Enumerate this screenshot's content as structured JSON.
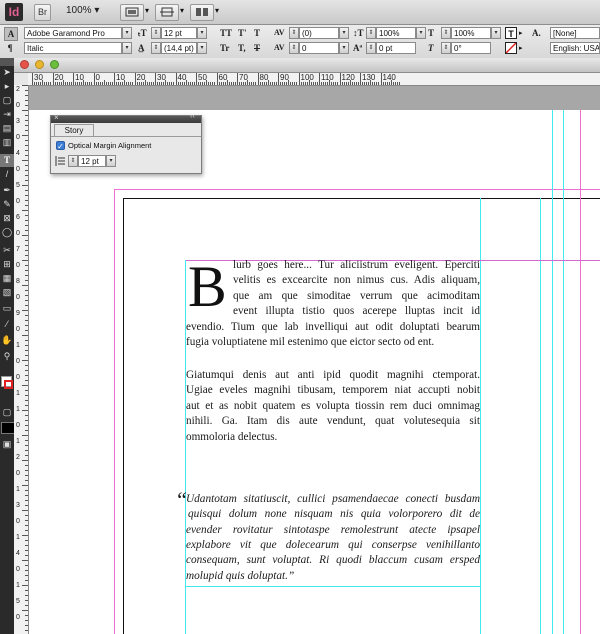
{
  "app": {
    "logo": "Id",
    "bridge_label": "Br",
    "zoom": "100%",
    "menu_caret": "▾"
  },
  "control": {
    "font_family": "Adobe Garamond Pro",
    "font_style": "Italic",
    "font_size": "12 pt",
    "leading": "(14,4 pt)",
    "kerning": "(0)",
    "tracking": "0",
    "vertical_scale": "100%",
    "horizontal_scale": "100%",
    "baseline_shift": "0 pt",
    "skew": "0°",
    "char_style": "[None]",
    "language": "English: USA",
    "glyph_tt": "TT",
    "glyph_tsup": "T'",
    "glyph_t": "T",
    "glyph_tr": "Tr",
    "glyph_tsub": "T,",
    "glyph_tunder": "T",
    "glyph_a": "A."
  },
  "ruler": {
    "h_labels": [
      "30",
      "20",
      "10",
      "0",
      "10",
      "20",
      "30",
      "40",
      "50",
      "60",
      "70",
      "80",
      "90",
      "100",
      "110",
      "120",
      "130",
      "140"
    ],
    "v_labels": [
      "2",
      "0",
      "3",
      "0",
      "4",
      "0",
      "5",
      "0",
      "6",
      "0",
      "7",
      "0",
      "8",
      "0",
      "9",
      "0",
      "1",
      "0",
      "0",
      "1",
      "1",
      "0",
      "1",
      "2",
      "0",
      "1",
      "3",
      "0",
      "1",
      "4",
      "0",
      "1",
      "5",
      "0"
    ]
  },
  "story_panel": {
    "title": "Story",
    "option_label": "Optical Margin Alignment",
    "option_checked": true,
    "size_value": "12 pt",
    "close_glyph": "×",
    "collapse_glyph": "‹‹"
  },
  "text_frame": {
    "drop_cap": "B",
    "para1_lines": [
      "lurb goes here... Tur aliciistrum eveligent. Eperciti",
      "velitis es excearcite non nimus cus. Adis aliquam,",
      "que am que simoditae verrum que acimoditam",
      "event illupta tistio quos acerepe lluptas incit id",
      "evendio. Tium que lab invelliqui aut odit doluptati bearum",
      "fugia voluptiatene mil estenimo que eictor secto od ent."
    ],
    "para2_lines": [
      "Giatumqui denis aut anti ipid quodit magnihi ctemporat.",
      "Ugiae eveles magnihi tibusam, temporem niat accupti nobit",
      "aut et as nobit quatem es volupta tiossin rem duci omnimag",
      "nihili. Ga. Itam dis aute vendunt, quat volutesequia sit",
      "ommoloria delectus."
    ],
    "quote_mark": "“",
    "quote_lines": [
      "Udantotam sitatiuscit, cullici psamendaecae conecti busdam",
      "quisqui dolum none nisquam nis quia volorporero dit de",
      "evender rovitatur sintotaspe remolestrunt atecte ipsapel",
      "explabore vit que dolecearum qui conserpse venihillanto",
      "consequam, sunt voluptat. Ri quodi blaccum cusam ersped",
      "molupid quis doluptat.”"
    ]
  }
}
